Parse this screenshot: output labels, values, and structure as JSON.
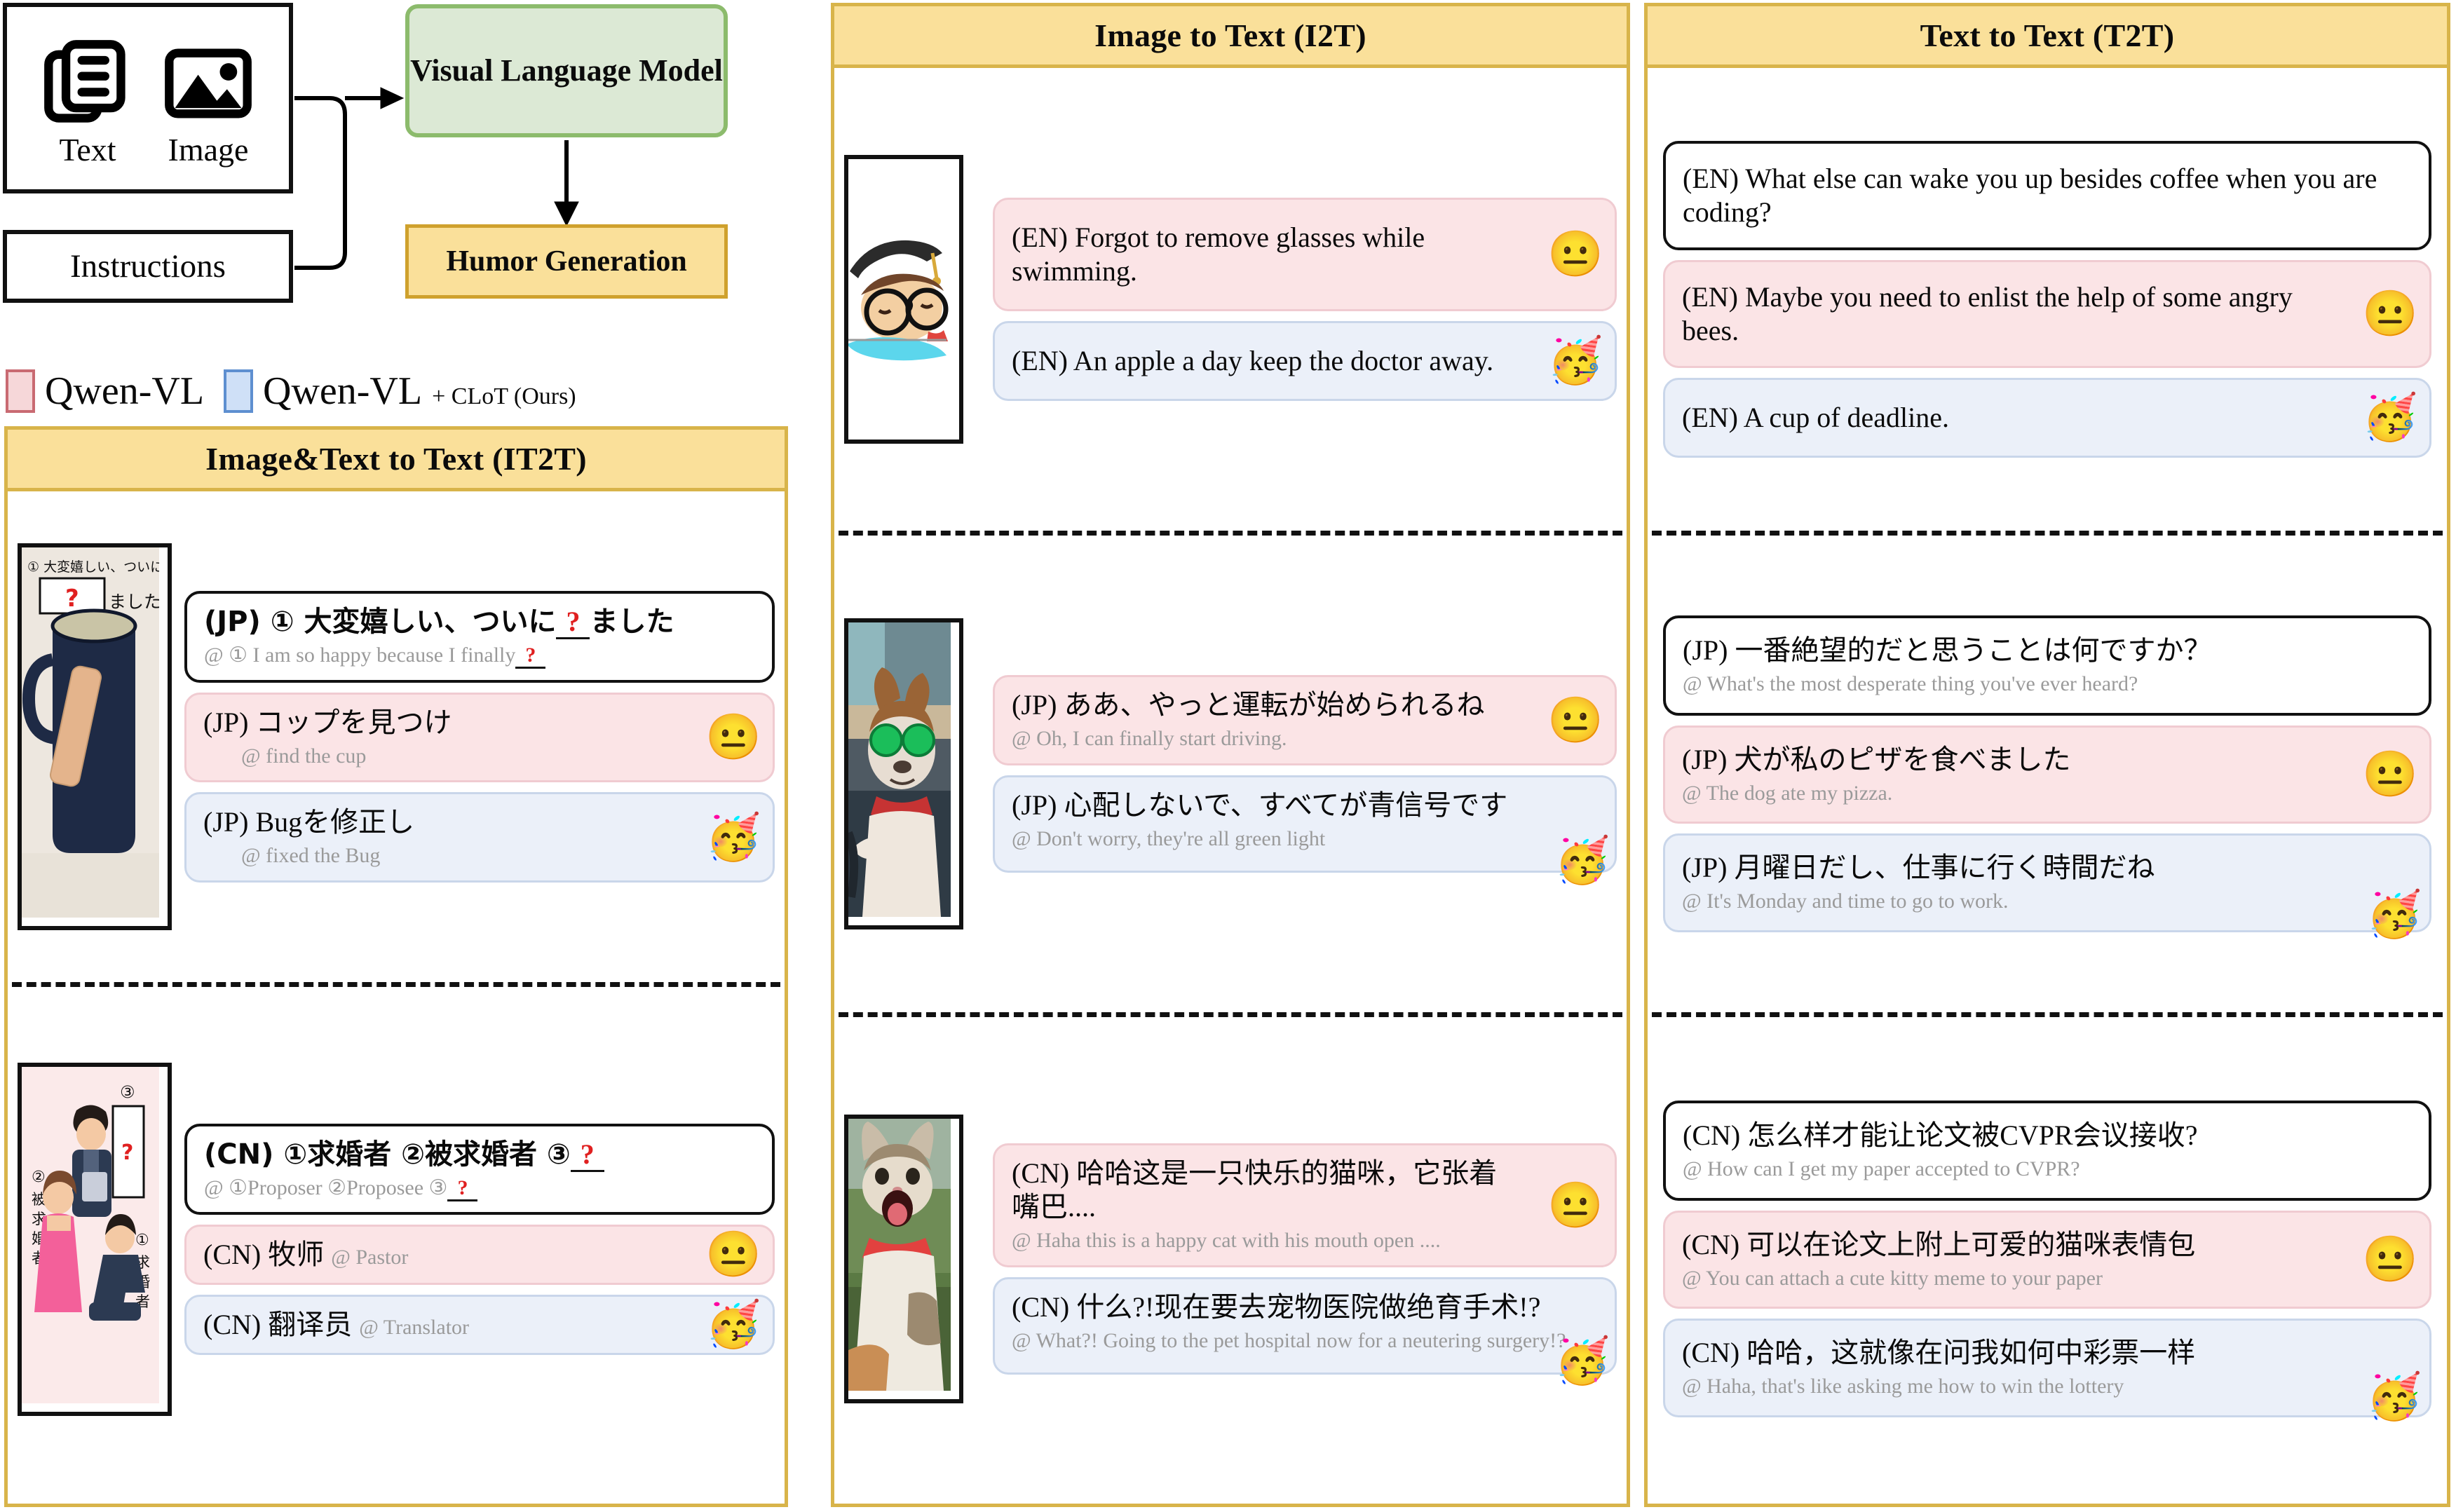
{
  "diagram": {
    "inputs": {
      "text_label": "Text",
      "image_label": "Image",
      "text_icon": "document-stack-icon",
      "image_icon": "picture-icon"
    },
    "instructions_label": "Instructions",
    "vlm_label": "Visual Language Model",
    "humor_label": "Humor Generation",
    "colors": {
      "vlm_fill": "#DCE9D5",
      "vlm_border": "#8CBB6C",
      "humor_fill": "#FAE09A",
      "humor_border": "#CFA12D"
    }
  },
  "legend": {
    "items": [
      {
        "label": "Qwen-VL",
        "sub": "",
        "swatch": "#F6D7D9",
        "swatch_border": "#C96A72"
      },
      {
        "label": "Qwen-VL",
        "sub": "+ CLoT (Ours)",
        "swatch": "#CFE0F7",
        "swatch_border": "#5E8FD0"
      }
    ]
  },
  "panels": [
    {
      "id": "it2t",
      "title": "Image&Text to Text (IT2T)",
      "rows": [
        {
          "thumb": "mug-with-bandage-photo",
          "bubbles": [
            {
              "kind": "white",
              "main_pre": "(JP) ① 大変嬉しい、ついに",
              "blank": "?",
              "main_post": "ました",
              "gloss_pre": "@ ① I am so happy because I finally",
              "gloss_blank": "?",
              "emoji": ""
            },
            {
              "kind": "pink",
              "main": "(JP) コップを見つけ",
              "gloss": "@ find the cup",
              "emoji": "😐"
            },
            {
              "kind": "blue",
              "main": "(JP) Bugを修正し",
              "gloss": "@ fixed the Bug",
              "emoji": "🥳"
            }
          ]
        },
        {
          "thumb": "proposal-illustration",
          "bubbles": [
            {
              "kind": "white",
              "main_pre": "(CN) ①求婚者 ②被求婚者 ③",
              "blank": "?",
              "main_post": "",
              "gloss_pre": "@ ①Proposer ②Proposee ③",
              "gloss_blank": "?",
              "emoji": ""
            },
            {
              "kind": "pink",
              "main": "(CN) 牧师",
              "gloss": "@ Pastor",
              "gloss_inline": true,
              "emoji": "😐"
            },
            {
              "kind": "blue",
              "main": "(CN) 翻译员",
              "gloss": "@ Translator",
              "gloss_inline": true,
              "emoji": "🥳"
            }
          ]
        }
      ]
    },
    {
      "id": "i2t",
      "title": "Image to Text (I2T)",
      "rows": [
        {
          "thumb": "graduate-swimming-with-glasses",
          "bubbles": [
            {
              "kind": "pink",
              "main": "(EN) Forgot to remove glasses while swimming.",
              "gloss": "",
              "emoji": "😐"
            },
            {
              "kind": "blue",
              "main": "(EN) An apple a day keep the doctor away.",
              "gloss": "",
              "emoji": "🥳"
            }
          ]
        },
        {
          "thumb": "dog-driving-with-sunglasses",
          "bubbles": [
            {
              "kind": "pink",
              "main": "(JP) ああ、やっと運転が始められるね",
              "gloss": "@ Oh, I can finally start driving.",
              "emoji": "😐"
            },
            {
              "kind": "blue",
              "main": "(JP) 心配しないで、すべてが青信号です",
              "gloss": "@ Don't worry, they're all green light",
              "emoji": "🥳"
            }
          ]
        },
        {
          "thumb": "screaming-cat-photo",
          "bubbles": [
            {
              "kind": "pink",
              "main": "(CN) 哈哈这是一只快乐的猫咪，它张着嘴巴....",
              "gloss": "@ Haha this is a happy cat with his mouth open ....",
              "emoji": "😐"
            },
            {
              "kind": "blue",
              "main": "(CN) 什么?!现在要去宠物医院做绝育手术!?",
              "gloss": "@ What?! Going to the pet hospital now for a neutering surgery!?",
              "emoji": "🥳"
            }
          ]
        }
      ]
    },
    {
      "id": "t2t",
      "title": "Text to Text (T2T)",
      "rows": [
        {
          "thumb": null,
          "bubbles": [
            {
              "kind": "white",
              "main": "(EN) What else can wake you up besides coffee when you are coding?",
              "gloss": "",
              "emoji": ""
            },
            {
              "kind": "pink",
              "main": "(EN) Maybe you need to enlist the help of some angry bees.",
              "gloss": "",
              "emoji": "😐"
            },
            {
              "kind": "blue",
              "main": "(EN) A cup of deadline.",
              "gloss": "",
              "emoji": "🥳"
            }
          ]
        },
        {
          "thumb": null,
          "bubbles": [
            {
              "kind": "white",
              "main": "(JP) 一番絶望的だと思うことは何ですか？",
              "gloss": "@ What's the most desperate thing you've ever heard?",
              "emoji": ""
            },
            {
              "kind": "pink",
              "main": "(JP) 犬が私のピザを食べました",
              "gloss": "@ The dog ate my pizza.",
              "emoji": "😐"
            },
            {
              "kind": "blue",
              "main": "(JP) 月曜日だし、仕事に行く時間だね",
              "gloss": "@ It's Monday and time to go to work.",
              "emoji": "🥳"
            }
          ]
        },
        {
          "thumb": null,
          "bubbles": [
            {
              "kind": "white",
              "main": "(CN) 怎么样才能让论文被CVPR会议接收?",
              "gloss": "@ How can I get my paper accepted to  CVPR?",
              "emoji": ""
            },
            {
              "kind": "pink",
              "main": "(CN) 可以在论文上附上可爱的猫咪表情包",
              "gloss": "@ You can attach a cute kitty meme to your paper",
              "emoji": "😐"
            },
            {
              "kind": "blue",
              "main": "(CN) 哈哈，这就像在问我如何中彩票一样",
              "gloss": "@ Haha, that's like asking me how to win the lottery",
              "emoji": "🥳"
            }
          ]
        }
      ]
    }
  ],
  "thumb_texts": {
    "mug_line1": "① 大変嬉しい、ついに",
    "mug_q": "?",
    "mug_line2": "ました",
    "proposal_3": "③",
    "proposal_q": "?",
    "proposal_2": "②被求婚者",
    "proposal_1": "①求婚者"
  },
  "colors": {
    "panel_border": "#D8B44A",
    "header_fill": "#FAE09A",
    "pink_fill": "#FBE4E6",
    "pink_border": "#F0CBD1",
    "blue_fill": "#EBF0F9",
    "blue_border": "#C9D6EA",
    "gloss_text": "#9A9A9A",
    "blank_red": "#E02020"
  }
}
